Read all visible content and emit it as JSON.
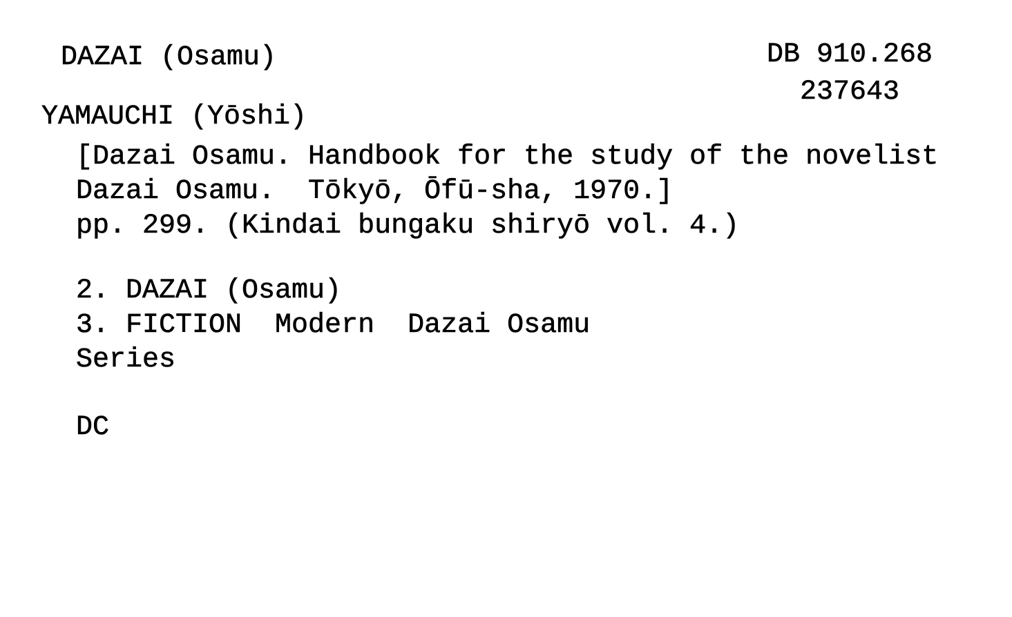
{
  "card": {
    "heading": "DAZAI (Osamu)",
    "call_number": "DB 910.268",
    "accession_number": "237643",
    "author": "YAMAUCHI (Yōshi)",
    "title_line_1": "[Dazai Osamu. Handbook for the study of the novelist",
    "title_line_2": "Dazai Osamu.  Tōkyō, Ōfū-sha, 1970.]",
    "collation": "pp. 299. (Kindai bungaku shiryō vol. 4.)",
    "tracings": [
      "2. DAZAI (Osamu)",
      "3. FICTION  Modern  Dazai Osamu",
      "Series"
    ],
    "cataloguer_initials": "DC"
  }
}
